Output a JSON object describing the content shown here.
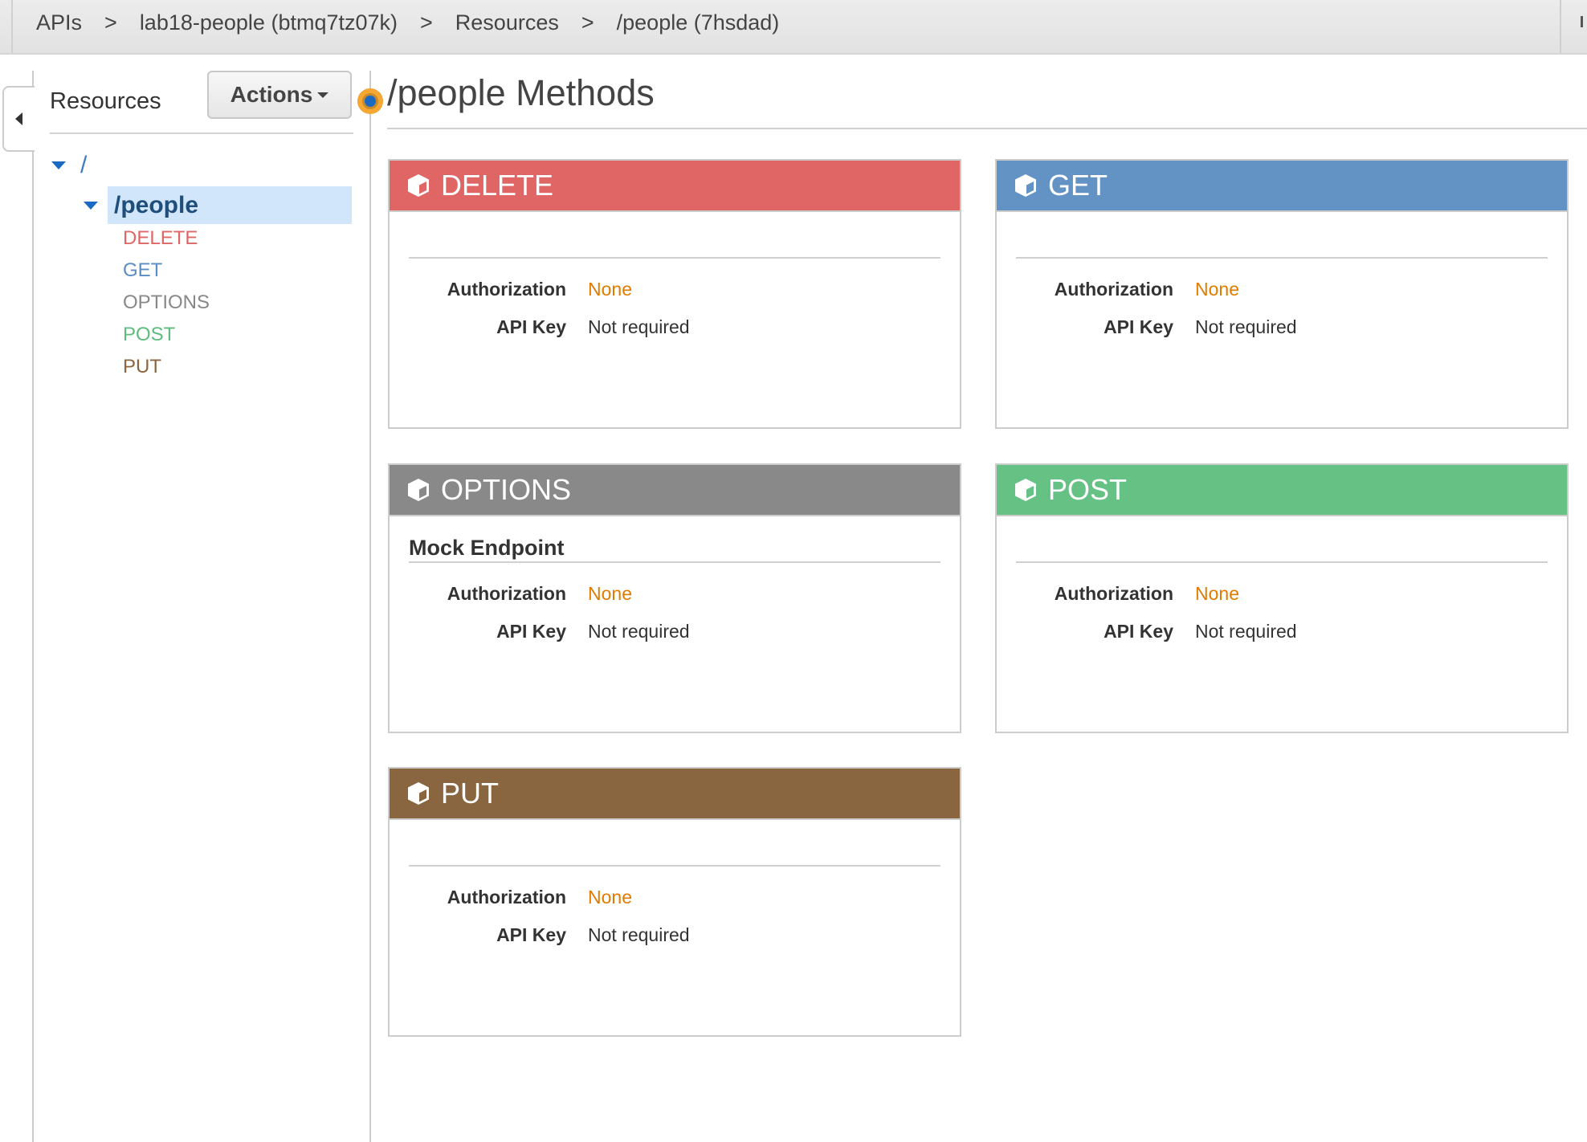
{
  "breadcrumb": [
    {
      "label": "APIs"
    },
    {
      "label": "lab18-people (btmq7tz07k)"
    },
    {
      "label": "Resources"
    },
    {
      "label": "/people (7hsdad)"
    }
  ],
  "breadcrumb_separator": ">",
  "sidebar": {
    "title": "Resources",
    "actions_label": "Actions",
    "tree": {
      "root": "/",
      "resource": "/people",
      "methods": [
        {
          "label": "DELETE",
          "color": "#e06666"
        },
        {
          "label": "GET",
          "color": "#5b8ec4"
        },
        {
          "label": "OPTIONS",
          "color": "#888888"
        },
        {
          "label": "POST",
          "color": "#5dbb7c"
        },
        {
          "label": "PUT",
          "color": "#8b6540"
        }
      ]
    }
  },
  "main": {
    "title": "/people Methods",
    "cards": [
      {
        "method": "DELETE",
        "color": "#e06666",
        "subtitle": "",
        "auth_label": "Authorization",
        "auth_value": "None",
        "key_label": "API Key",
        "key_value": "Not required"
      },
      {
        "method": "GET",
        "color": "#6392c4",
        "subtitle": "",
        "auth_label": "Authorization",
        "auth_value": "None",
        "key_label": "API Key",
        "key_value": "Not required"
      },
      {
        "method": "OPTIONS",
        "color": "#898989",
        "subtitle": "Mock Endpoint",
        "auth_label": "Authorization",
        "auth_value": "None",
        "key_label": "API Key",
        "key_value": "Not required"
      },
      {
        "method": "POST",
        "color": "#66c184",
        "subtitle": "",
        "auth_label": "Authorization",
        "auth_value": "None",
        "key_label": "API Key",
        "key_value": "Not required"
      },
      {
        "method": "PUT",
        "color": "#8a6640",
        "subtitle": "",
        "auth_label": "Authorization",
        "auth_value": "None",
        "key_label": "API Key",
        "key_value": "Not required"
      }
    ]
  }
}
